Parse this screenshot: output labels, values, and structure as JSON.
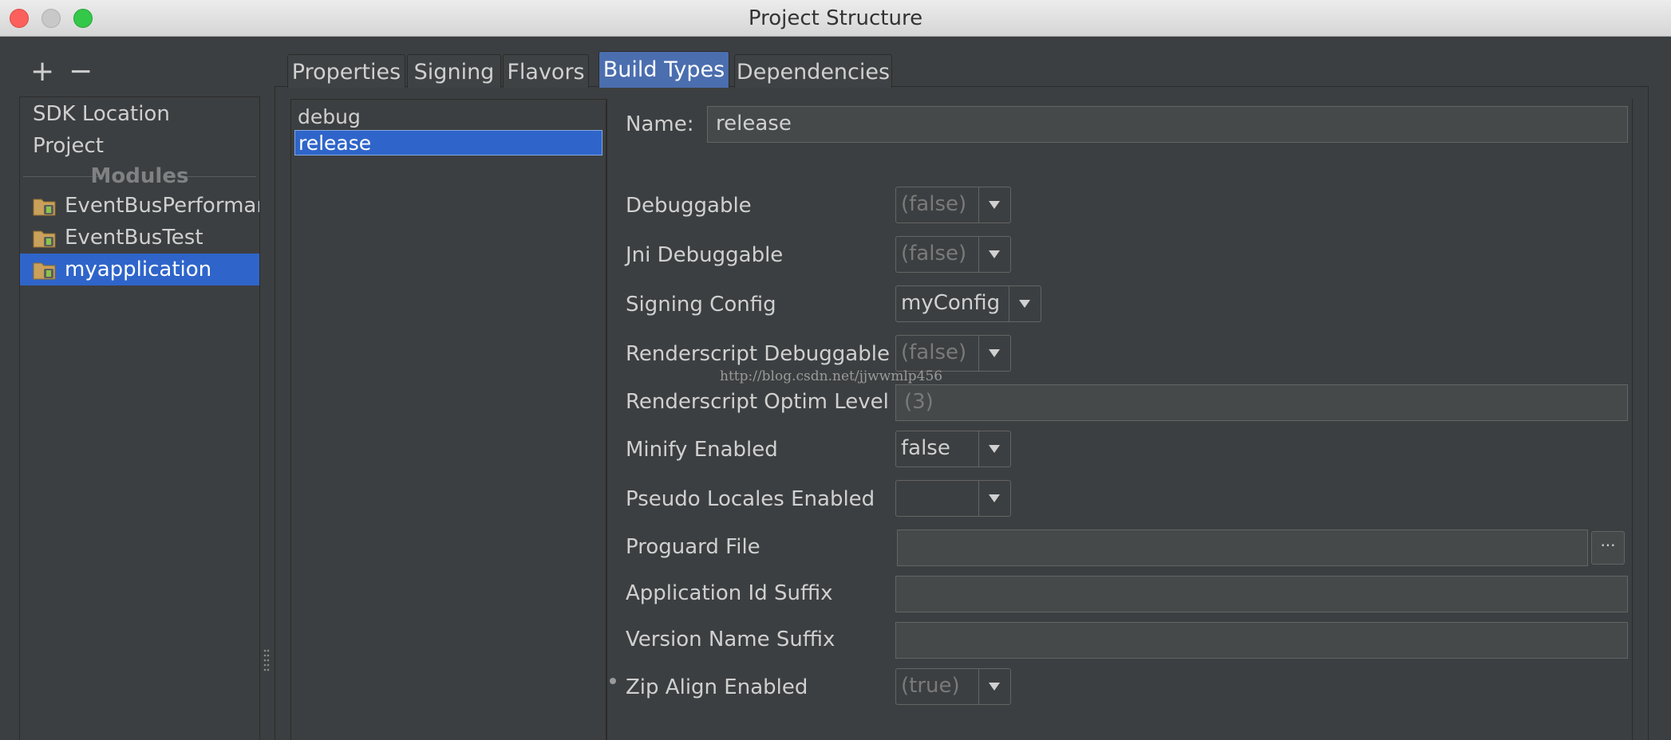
{
  "window": {
    "title": "Project Structure"
  },
  "toolbar": {
    "add_label": "+",
    "remove_label": "−"
  },
  "sidebar": {
    "items": [
      {
        "label": "SDK Location"
      },
      {
        "label": "Project"
      }
    ],
    "modules_header": "Modules",
    "modules": [
      {
        "label": "EventBusPerformance",
        "selected": false
      },
      {
        "label": "EventBusTest",
        "selected": false
      },
      {
        "label": "myapplication",
        "selected": true
      }
    ]
  },
  "tabs": [
    {
      "label": "Properties",
      "active": false
    },
    {
      "label": "Signing",
      "active": false
    },
    {
      "label": "Flavors",
      "active": false
    },
    {
      "label": "Build Types",
      "active": true
    },
    {
      "label": "Dependencies",
      "active": false
    }
  ],
  "build_types": [
    {
      "label": "debug",
      "selected": false
    },
    {
      "label": "release",
      "selected": true
    }
  ],
  "form": {
    "name_label": "Name:",
    "name_value": "release",
    "fields": {
      "debuggable": {
        "label": "Debuggable",
        "value": "(false)"
      },
      "jni_debuggable": {
        "label": "Jni Debuggable",
        "value": "(false)"
      },
      "signing_config": {
        "label": "Signing Config",
        "value": "myConfig"
      },
      "renderscript_debuggable": {
        "label": "Renderscript Debuggable",
        "value": "(false)"
      },
      "renderscript_optim_level": {
        "label": "Renderscript Optim Level",
        "value": "(3)"
      },
      "minify_enabled": {
        "label": "Minify Enabled",
        "value": "false"
      },
      "pseudo_locales_enabled": {
        "label": "Pseudo Locales Enabled",
        "value": ""
      },
      "proguard_file": {
        "label": "Proguard File",
        "value": ""
      },
      "application_id_suffix": {
        "label": "Application Id Suffix",
        "value": ""
      },
      "version_name_suffix": {
        "label": "Version Name Suffix",
        "value": ""
      },
      "zip_align_enabled": {
        "label": "Zip Align Enabled",
        "value": "(true)"
      }
    },
    "browse_label": "···"
  },
  "watermark": "http://blog.csdn.net/jjwwmlp456",
  "colors": {
    "background": "#3c3f41",
    "selection": "#2f65ca",
    "active_tab": "#4b6eaf",
    "text": "#d0d0d0"
  },
  "icons": {
    "close": "close-icon",
    "minimize": "minimize-icon",
    "zoom": "zoom-icon",
    "module": "android-module-folder-icon",
    "dropdown": "chevron-down-icon"
  }
}
